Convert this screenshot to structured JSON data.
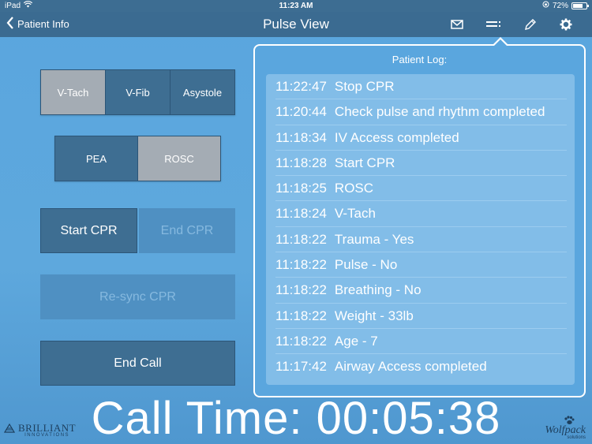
{
  "status_bar": {
    "device": "iPad",
    "time": "11:23 AM",
    "battery": "72%",
    "battery_level": 0.72
  },
  "nav": {
    "back_label": "Patient Info",
    "title": "Pulse View",
    "icons": [
      "mail-icon",
      "list-icon",
      "pencil-icon",
      "gear-icon"
    ]
  },
  "rhythm_buttons": {
    "vtach": "V-Tach",
    "vfib": "V-Fib",
    "asystole": "Asystole",
    "pea": "PEA",
    "rosc": "ROSC"
  },
  "cpr_buttons": {
    "start": "Start CPR",
    "end": "End CPR",
    "resync": "Re-sync CPR",
    "end_call": "End Call"
  },
  "log": {
    "title": "Patient Log:",
    "entries": [
      {
        "time": "11:22:47",
        "event": "Stop CPR"
      },
      {
        "time": "11:20:44",
        "event": "Check pulse and rhythm completed"
      },
      {
        "time": "11:18:34",
        "event": "IV Access completed"
      },
      {
        "time": "11:18:28",
        "event": "Start CPR"
      },
      {
        "time": "11:18:25",
        "event": "ROSC"
      },
      {
        "time": "11:18:24",
        "event": "V-Tach"
      },
      {
        "time": "11:18:22",
        "event": "Trauma - Yes"
      },
      {
        "time": "11:18:22",
        "event": "Pulse - No"
      },
      {
        "time": "11:18:22",
        "event": "Breathing - No"
      },
      {
        "time": "11:18:22",
        "event": "Weight - 33lb"
      },
      {
        "time": "11:18:22",
        "event": "Age - 7"
      },
      {
        "time": "11:17:42",
        "event": "Airway Access completed"
      }
    ]
  },
  "call_time": "Call Time: 00:05:38",
  "logos": {
    "left_name": "BRILLIANT",
    "left_sub": "INNOVATIONS",
    "right_name": "Wolfpack",
    "right_sub": "solutions"
  },
  "colors": {
    "background": "#5aa6de",
    "navbar": "#3b6b91",
    "button_dark": "#3e6e92",
    "button_selected": "#a4acb4",
    "log_panel": "#82bde8"
  }
}
